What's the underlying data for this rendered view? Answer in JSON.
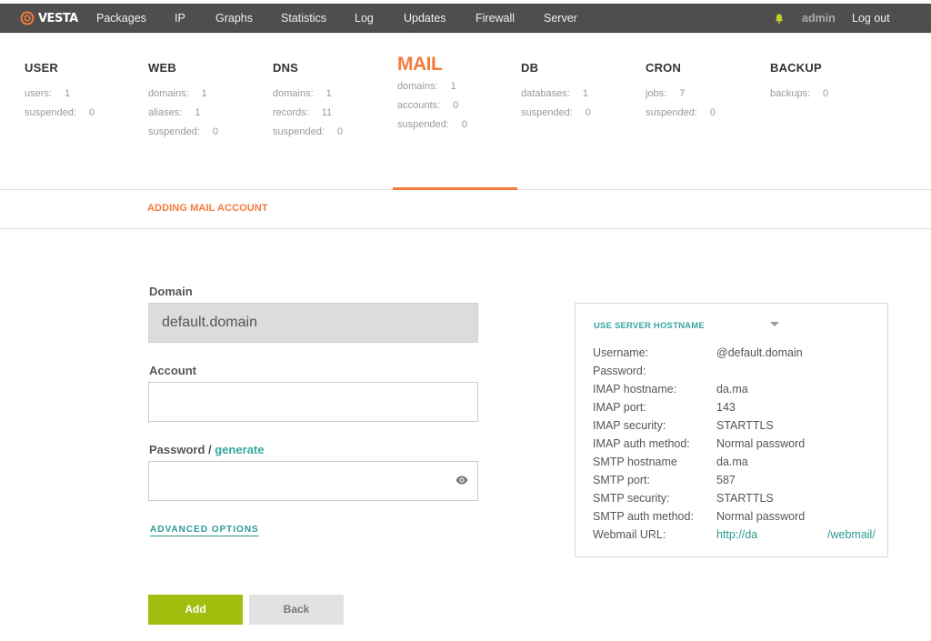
{
  "topbar": {
    "logo": "VESTA",
    "nav": [
      "Packages",
      "IP",
      "Graphs",
      "Statistics",
      "Log",
      "Updates",
      "Firewall",
      "Server"
    ],
    "user": "admin",
    "logout": "Log out"
  },
  "stats": [
    {
      "title": "USER",
      "rows": [
        [
          "users:",
          "1"
        ],
        [
          "suspended:",
          "0"
        ]
      ]
    },
    {
      "title": "WEB",
      "rows": [
        [
          "domains:",
          "1"
        ],
        [
          "aliases:",
          "1"
        ],
        [
          "suspended:",
          "0"
        ]
      ]
    },
    {
      "title": "DNS",
      "rows": [
        [
          "domains:",
          "1"
        ],
        [
          "records:",
          "11"
        ],
        [
          "suspended:",
          "0"
        ]
      ]
    },
    {
      "title": "MAIL",
      "rows": [
        [
          "domains:",
          "1"
        ],
        [
          "accounts:",
          "0"
        ],
        [
          "suspended:",
          "0"
        ]
      ]
    },
    {
      "title": "DB",
      "rows": [
        [
          "databases:",
          "1"
        ],
        [
          "suspended:",
          "0"
        ]
      ]
    },
    {
      "title": "CRON",
      "rows": [
        [
          "jobs:",
          "7"
        ],
        [
          "suspended:",
          "0"
        ]
      ]
    },
    {
      "title": "BACKUP",
      "rows": [
        [
          "backups:",
          "0"
        ]
      ]
    }
  ],
  "subhead": "ADDING MAIL ACCOUNT",
  "form": {
    "domain_label": "Domain",
    "domain_value": "default.domain",
    "account_label": "Account",
    "account_value": "",
    "password_label": "Password /",
    "generate": "generate",
    "password_value": "",
    "advanced": "ADVANCED OPTIONS",
    "add": "Add",
    "back": "Back"
  },
  "info": {
    "header": "USE SERVER HOSTNAME",
    "rows": [
      [
        "Username:",
        "@default.domain"
      ],
      [
        "Password:",
        ""
      ],
      [
        "IMAP hostname:",
        "da.ma"
      ],
      [
        "IMAP port:",
        "143"
      ],
      [
        "IMAP security:",
        "STARTTLS"
      ],
      [
        "IMAP auth method:",
        "Normal password"
      ],
      [
        "SMTP hostname",
        "da.ma"
      ],
      [
        "SMTP port:",
        "587"
      ],
      [
        "SMTP security:",
        "STARTTLS"
      ],
      [
        "SMTP auth method:",
        "Normal password"
      ]
    ],
    "webmail_label": "Webmail URL:",
    "webmail_left": "http://da",
    "webmail_right": "/webmail/"
  },
  "colors": {
    "accent": "#f47b3b",
    "teal": "#36a5a0",
    "add": "#9fbe0e",
    "topbar": "#4e4e4e"
  }
}
